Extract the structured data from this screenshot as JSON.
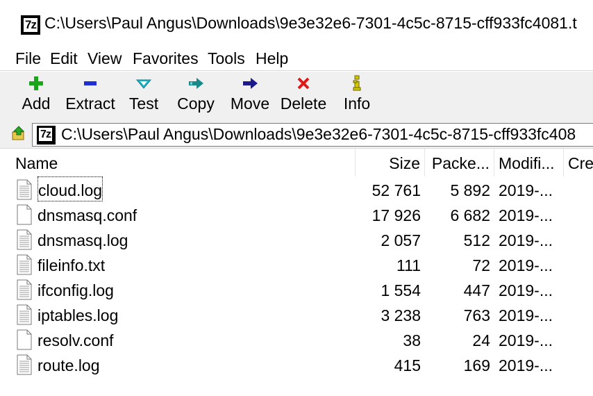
{
  "window": {
    "title": "C:\\Users\\Paul Angus\\Downloads\\9e3e32e6-7301-4c5c-8715-cff933fc4081.t",
    "app_icon_text": "7z"
  },
  "menu": {
    "items": [
      "File",
      "Edit",
      "View",
      "Favorites",
      "Tools",
      "Help"
    ]
  },
  "toolbar": {
    "add_label": "Add",
    "extract_label": "Extract",
    "test_label": "Test",
    "copy_label": "Copy",
    "move_label": "Move",
    "delete_label": "Delete",
    "info_label": "Info",
    "icons": {
      "add": "plus-icon",
      "extract": "minus-icon",
      "test": "checkmark-icon",
      "copy": "copy-arrow-icon",
      "move": "move-arrow-icon",
      "delete": "x-icon",
      "info": "info-icon"
    },
    "colors": {
      "add": "#1aa51a",
      "extract": "#1f2fd6",
      "test": "#1fb5c8",
      "copy": "#178a8a",
      "move": "#1a1a8c",
      "delete": "#e01818",
      "info": "#d4c800"
    }
  },
  "address": {
    "path": "C:\\Users\\Paul Angus\\Downloads\\9e3e32e6-7301-4c5c-8715-cff933fc408",
    "icon_text": "7z"
  },
  "columns": {
    "name": "Name",
    "size": "Size",
    "packed": "Packe...",
    "modified": "Modifi...",
    "created": "Cre"
  },
  "files": [
    {
      "name": "cloud.log",
      "size": "52 761",
      "packed": "5 892",
      "modified": "2019-...",
      "icon": "text-file-icon"
    },
    {
      "name": "dnsmasq.conf",
      "size": "17 926",
      "packed": "6 682",
      "modified": "2019-...",
      "icon": "blank-file-icon"
    },
    {
      "name": "dnsmasq.log",
      "size": "2 057",
      "packed": "512",
      "modified": "2019-...",
      "icon": "text-file-icon"
    },
    {
      "name": "fileinfo.txt",
      "size": "111",
      "packed": "72",
      "modified": "2019-...",
      "icon": "text-file-icon"
    },
    {
      "name": "ifconfig.log",
      "size": "1 554",
      "packed": "447",
      "modified": "2019-...",
      "icon": "text-file-icon"
    },
    {
      "name": "iptables.log",
      "size": "3 238",
      "packed": "763",
      "modified": "2019-...",
      "icon": "text-file-icon"
    },
    {
      "name": "resolv.conf",
      "size": "38",
      "packed": "24",
      "modified": "2019-...",
      "icon": "blank-file-icon"
    },
    {
      "name": "route.log",
      "size": "415",
      "packed": "169",
      "modified": "2019-...",
      "icon": "text-file-icon"
    }
  ]
}
